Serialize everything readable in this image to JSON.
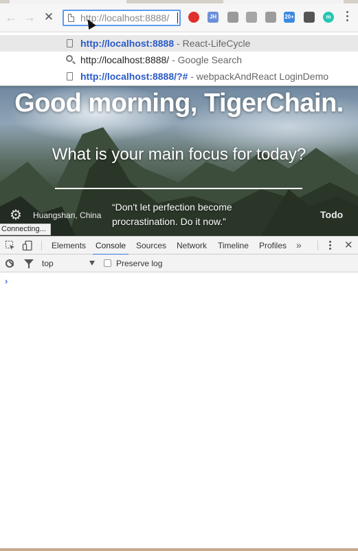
{
  "toolbar": {
    "back_glyph": "←",
    "forward_glyph": "→",
    "stop_glyph": "✕",
    "url_host": "http://localhost",
    "url_port": ":8888/",
    "extensions": [
      {
        "icon": "adblock-icon",
        "label": "",
        "color": "#e0302d"
      },
      {
        "icon": "jh-icon",
        "label": "JH",
        "color": "#6d8fd8"
      },
      {
        "icon": "shield-icon",
        "label": "",
        "color": "#9a9a9a"
      },
      {
        "icon": "globe-icon",
        "label": "",
        "color": "#a6a6a6"
      },
      {
        "icon": "qr-icon",
        "label": "",
        "color": "#9c9c9c"
      },
      {
        "icon": "badge-icon",
        "label": "20+",
        "color": "#3c8be0"
      },
      {
        "icon": "ghost-icon",
        "label": "",
        "color": "#555555"
      },
      {
        "icon": "m-icon",
        "label": "m",
        "color": "#23c7b3"
      }
    ]
  },
  "suggestions": [
    {
      "icon": "page-icon",
      "url": "http://localhost:8888",
      "url_style": "bold",
      "desc": " - React-LifeCycle"
    },
    {
      "icon": "search-icon",
      "url": "http://localhost:8888/",
      "url_style": "plain",
      "desc": " - Google Search"
    },
    {
      "icon": "page-icon",
      "url": "http://localhost:8888/?#",
      "url_style": "bold",
      "desc": " - webpackAndReact LoginDemo"
    }
  ],
  "page": {
    "greeting": "Good morning, TigerChain.",
    "focus_question": "What is your main focus for today?",
    "location": "Huangshan, China",
    "quote": "“Don't let perfection become procrastination. Do it now.”",
    "todo": "Todo",
    "gear_glyph": "⚙"
  },
  "status": {
    "text": "Connecting..."
  },
  "devtools": {
    "tabs": [
      {
        "label": "Elements",
        "active": false
      },
      {
        "label": "Console",
        "active": true
      },
      {
        "label": "Sources",
        "active": false
      },
      {
        "label": "Network",
        "active": false
      },
      {
        "label": "Timeline",
        "active": false
      },
      {
        "label": "Profiles",
        "active": false
      }
    ],
    "more_glyph": "»",
    "close_glyph": "✕",
    "context": "top",
    "preserve_log": "Preserve log",
    "prompt_glyph": "›"
  }
}
